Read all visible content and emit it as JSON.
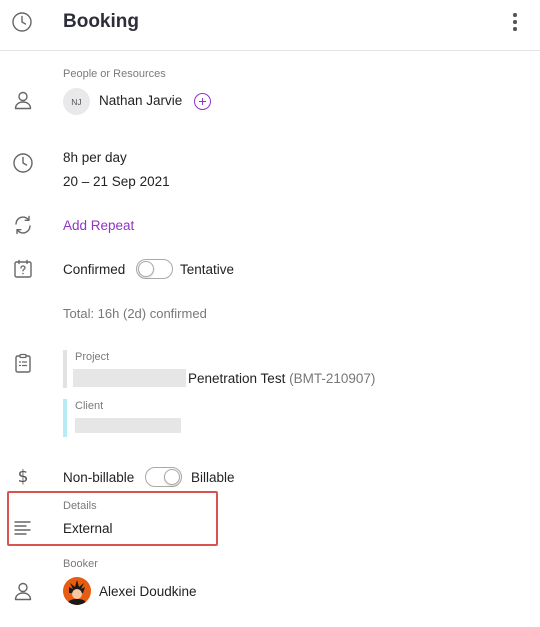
{
  "header": {
    "title": "Booking",
    "icon": "clock-icon",
    "menu_icon": "more-vertical-icon"
  },
  "people": {
    "label": "People or Resources",
    "initials": "NJ",
    "name": "Nathan Jarvie",
    "add_icon": "plus-circle-icon"
  },
  "schedule": {
    "hours": "8h per day",
    "dates": "20 – 21 Sep 2021"
  },
  "repeat": {
    "label": "Add Repeat"
  },
  "status": {
    "left_label": "Confirmed",
    "right_label": "Tentative",
    "total": "Total: 16h (2d) confirmed"
  },
  "project": {
    "label": "Project",
    "name": "Penetration Test",
    "code": "(BMT-210907)",
    "client_label": "Client"
  },
  "billing": {
    "left_label": "Non-billable",
    "right_label": "Billable"
  },
  "details": {
    "label": "Details",
    "value": "External"
  },
  "booker": {
    "label": "Booker",
    "name": "Alexei Doudkine"
  },
  "colors": {
    "accent": "#8e35c4",
    "project_bar": "#e2e2e2",
    "client_bar": "#b8ecf5",
    "highlight": "#d9534f"
  }
}
